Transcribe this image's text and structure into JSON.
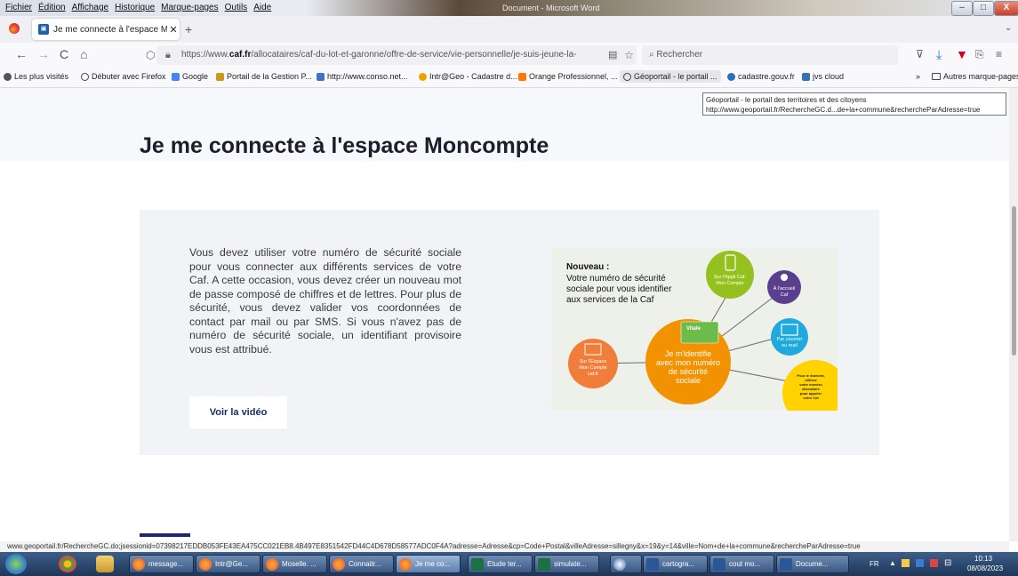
{
  "menu": [
    "Fichier",
    "Édition",
    "Affichage",
    "Historique",
    "Marque-pages",
    "Outils",
    "Aide"
  ],
  "window_title": "Document - Microsoft Word",
  "window_buttons": {
    "minimize": "–",
    "maximize": "□",
    "close": "X"
  },
  "tabs": [
    {
      "title": "Je me connecte à l'espace Mon"
    }
  ],
  "new_tab": "+",
  "nav": {
    "back": "←",
    "forward": "→",
    "reload": "C",
    "home": "⌂"
  },
  "url": {
    "prefix": "https://www.",
    "domain": "caf.fr",
    "path": "/allocataires/caf-du-lot-et-garonne/offre-de-service/vie-personnelle/je-suis-jeune-la-"
  },
  "search": {
    "placeholder": "Rechercher"
  },
  "bookmarks": [
    {
      "label": "Les plus visités",
      "icon": "gear-icon"
    },
    {
      "label": "Débuter avec Firefox",
      "icon": "globe-icon"
    },
    {
      "label": "Google",
      "icon": "google-icon"
    },
    {
      "label": "Portail de la Gestion P...",
      "icon": "portal-icon"
    },
    {
      "label": "http://www.conso.net...",
      "icon": "conso-icon"
    },
    {
      "label": "Intr@Geo - Cadastre d...",
      "icon": "intrageo-icon"
    },
    {
      "label": "Orange Professionnel, ...",
      "icon": "orange-icon"
    },
    {
      "label": "Géoportail - le portail ...",
      "icon": "globe-icon"
    },
    {
      "label": "cadastre.gouv.fr",
      "icon": "cadastre-icon"
    },
    {
      "label": "jvs cloud",
      "icon": "jvs-icon"
    }
  ],
  "other_bookmarks": "Autres marque-pages",
  "tooltip": {
    "line1": "Géoportail - le portail des territoires et des citoyens",
    "line2": "http://www.geoportail.fr/RechercheGC.d...de+la+commune&rechercheParAdresse=true"
  },
  "page": {
    "title": "Je me connecte à l'espace Moncompte",
    "body": "Vous devez utiliser votre numéro de sécurité sociale pour vous connecter aux différents services de votre Caf. A cette occasion, vous devez créer un nouveau mot de passe composé de chiffres et de lettres. Pour plus de sécurité, vous devez valider vos coordonnées de contact par mail ou par SMS. Si vous n'avez pas de numéro de sécurité sociale, un identifiant provisoire vous est attribué.",
    "video_button": "Voir la vidéo"
  },
  "infographic": {
    "heading": "Nouveau :",
    "subheading_lines": [
      "Votre numéro de sécurité",
      "sociale pour vous identifier",
      "aux services de la Caf"
    ],
    "center_lines": [
      "Je m'identifie",
      "avec mon numéro",
      "de sécurité",
      "sociale"
    ],
    "vitale": "Vitale",
    "app_lines": [
      "Sur l'Appli Caf-",
      "Mon Compte"
    ],
    "accueil_lines": [
      "À l'accueil",
      "Caf"
    ],
    "courrier_lines": [
      "Par courrier",
      "ou mail"
    ],
    "espace_lines": [
      "Sur l'Espace",
      "Mon Compte",
      "caf.fr"
    ],
    "yellow_lines": [
      "Pour le moment,",
      "utilisez",
      "votre numéro",
      "allocataire",
      "pour appeler",
      "votre Caf"
    ],
    "colors": {
      "center": "#f39200",
      "app": "#95c11f",
      "accueil": "#5b3f8f",
      "courrier": "#1fa9dc",
      "espace": "#f07e3a",
      "yellow": "#ffd200"
    }
  },
  "status_url": "www.geoportail.fr/RechercheGC.do;jsessionid=07398217EDDB053FE43EA475CC021EB8.4B497E8351542FD44C4D678D58577ADC0F4A?adresse=Adresse&cp=Code+Postal&villeAdresse=sillegny&x=19&y=14&ville=Nom+de+la+commune&rechercheParAdresse=true",
  "taskbar": [
    {
      "label": "message...",
      "icon": "firefox-icon"
    },
    {
      "label": "Intr@Ge...",
      "icon": "firefox-icon"
    },
    {
      "label": "Moselle. ...",
      "icon": "firefox-icon"
    },
    {
      "label": "Connaitr...",
      "icon": "firefox-icon"
    },
    {
      "label": "Je me co...",
      "icon": "firefox-icon",
      "active": true
    },
    {
      "label": "Etude ter...",
      "icon": "excel-icon"
    },
    {
      "label": "simulate...",
      "icon": "excel-icon"
    },
    {
      "label": "",
      "icon": "app-icon"
    },
    {
      "label": "cartogra...",
      "icon": "word-icon"
    },
    {
      "label": "cout mo...",
      "icon": "word-icon"
    },
    {
      "label": "Docume...",
      "icon": "word-icon"
    }
  ],
  "tray": {
    "lang": "FR",
    "time": "10:13",
    "date": "08/08/2023"
  }
}
